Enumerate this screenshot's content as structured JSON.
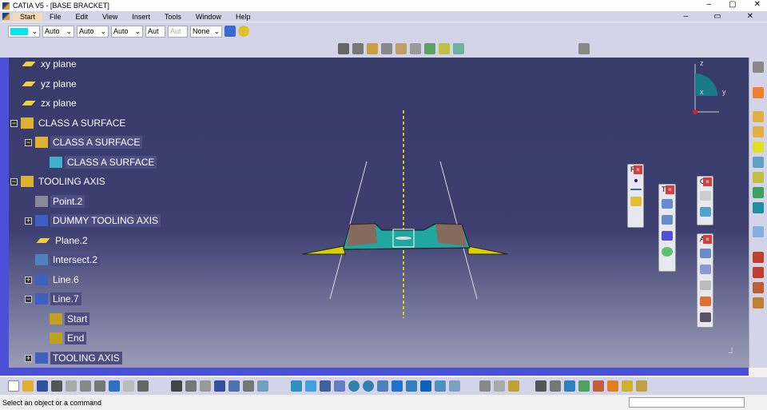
{
  "window": {
    "title": "CATIA V5 - [BASE BRACKET]",
    "min": "–",
    "max": "▢",
    "close": "✕"
  },
  "menu": [
    "Start",
    "File",
    "Edit",
    "View",
    "Insert",
    "Tools",
    "Window",
    "Help"
  ],
  "doc_controls": {
    "min": "–",
    "restore": "▭",
    "close": "✕"
  },
  "props": {
    "color": "#00e5ee",
    "linetype": "Auto",
    "thickness": "Auto",
    "linestyle": "Auto",
    "layer": "Aut",
    "layer2": "Aut",
    "filter": "None"
  },
  "tree": [
    {
      "label": "xy plane",
      "level": 1,
      "icon": "plane"
    },
    {
      "label": "yz plane",
      "level": 1,
      "icon": "plane"
    },
    {
      "label": "zx plane",
      "level": 1,
      "icon": "plane"
    },
    {
      "label": "CLASS A SURFACE",
      "level": 1,
      "icon": "geoset",
      "toggle": "−"
    },
    {
      "label": "CLASS A SURFACE",
      "level": 2,
      "icon": "geoset",
      "toggle": "−",
      "hl": true
    },
    {
      "label": "CLASS A SURFACE",
      "level": 3,
      "icon": "surface",
      "hl": true
    },
    {
      "label": "TOOLING AXIS",
      "level": 1,
      "icon": "geoset",
      "toggle": "−"
    },
    {
      "label": "Point.2",
      "level": 2,
      "icon": "point",
      "hl": true
    },
    {
      "label": "DUMMY TOOLING AXIS",
      "level": 2,
      "icon": "line",
      "toggle": "+",
      "hl": true
    },
    {
      "label": "Plane.2",
      "level": 2,
      "icon": "plane"
    },
    {
      "label": "Intersect.2",
      "level": 2,
      "icon": "intersect",
      "hl": true
    },
    {
      "label": "Line.6",
      "level": 2,
      "icon": "line",
      "toggle": "+"
    },
    {
      "label": "Line.7",
      "level": 2,
      "icon": "line",
      "toggle": "−",
      "hl": true
    },
    {
      "label": "Start",
      "level": 3,
      "icon": "box",
      "hl": true
    },
    {
      "label": "End",
      "level": 3,
      "icon": "box",
      "hl": true
    },
    {
      "label": "TOOLING AXIS",
      "level": 2,
      "icon": "line",
      "toggle": "+",
      "hl": true
    }
  ],
  "panels": [
    {
      "title": "R",
      "close": "×"
    },
    {
      "title": "T",
      "close": "×"
    },
    {
      "title": "C",
      "close": "×"
    },
    {
      "title": "A",
      "close": "×"
    }
  ],
  "compass": {
    "x": "x",
    "y": "y",
    "z": "z"
  },
  "status": {
    "message": "Select an object or a command"
  },
  "colors": {
    "viewport_top": "#373b6a",
    "viewport_bottom": "#9a9cb8",
    "accent": "#4a50d8"
  }
}
